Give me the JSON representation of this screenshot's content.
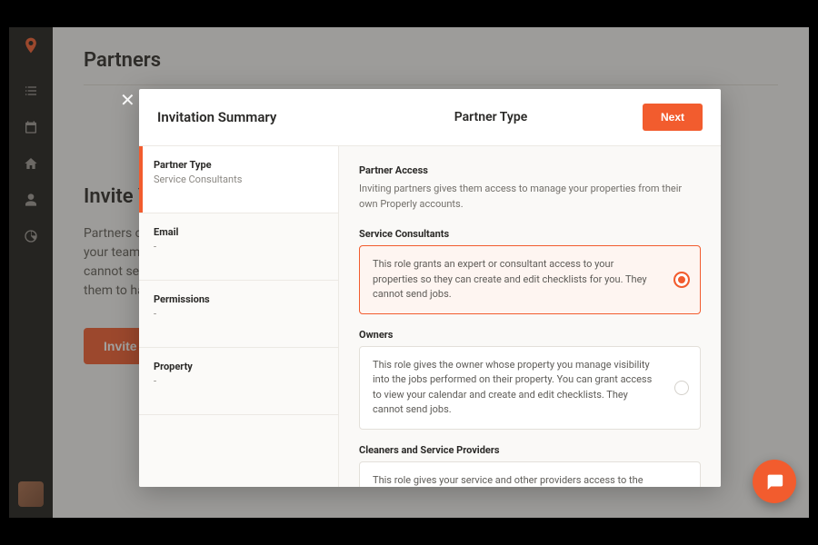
{
  "page": {
    "title": "Partners",
    "invite_heading": "Invite Your Partners",
    "invite_desc": "Partners can be, for example, cleaning companies you work with to help you and your team quickly make and edit checklists for your services. These partners cannot send jobs, manage your calendar. (You can tell your partners to invite them to have access.)",
    "invite_button": "Invite Partner"
  },
  "modal": {
    "summary_title": "Invitation Summary",
    "header_title": "Partner Type",
    "next_button": "Next",
    "summary": [
      {
        "label": "Partner Type",
        "value": "Service Consultants",
        "active": true
      },
      {
        "label": "Email",
        "value": "-",
        "active": false
      },
      {
        "label": "Permissions",
        "value": "-",
        "active": false
      },
      {
        "label": "Property",
        "value": "-",
        "active": false
      }
    ],
    "access": {
      "heading": "Partner Access",
      "description": "Inviting partners gives them access to manage your properties from their own Properly accounts."
    },
    "roles": [
      {
        "name": "Service Consultants",
        "description": "This role grants an expert or consultant access to your properties so they can create and edit checklists for you. They cannot send jobs.",
        "selected": true
      },
      {
        "name": "Owners",
        "description": "This role gives the owner whose property you manage visibility into the jobs performed on their property. You can grant access to view your calendar and create and edit checklists. They cannot send jobs.",
        "selected": false
      },
      {
        "name": "Cleaners and Service Providers",
        "description": "This role gives your service and other providers access to the booking calendar for the properties they service and lets them schedule their own jobs.",
        "selected": false
      }
    ]
  },
  "sidebar": {
    "items": [
      "logo",
      "checklist",
      "calendar",
      "home",
      "person",
      "chart"
    ]
  }
}
